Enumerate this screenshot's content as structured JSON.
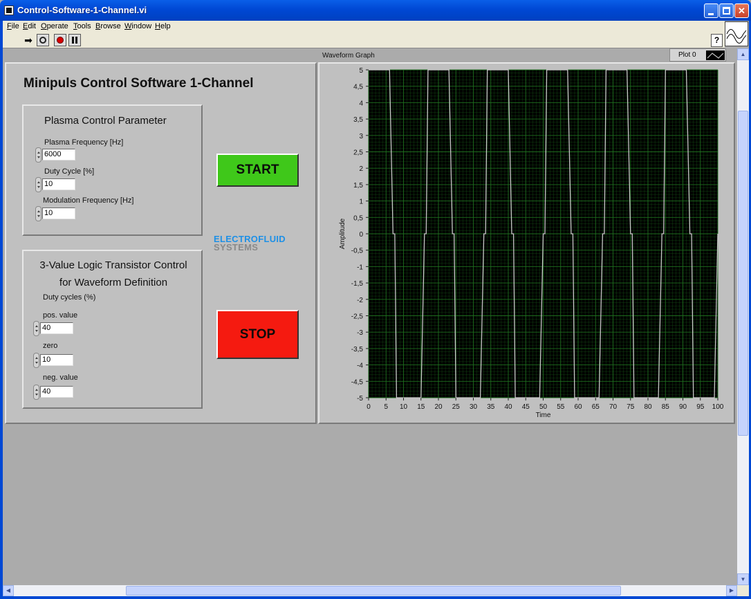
{
  "window": {
    "title": "Control-Software-1-Channel.vi"
  },
  "menu": [
    "File",
    "Edit",
    "Operate",
    "Tools",
    "Browse",
    "Window",
    "Help"
  ],
  "toolbar": {
    "run_icon": "run-arrow-icon",
    "run_cont_icon": "run-continuously-icon",
    "abort_icon": "abort-icon",
    "pause_icon": "pause-icon",
    "help_label": "?"
  },
  "front_panel": {
    "title": "Minipuls Control Software 1-Channel",
    "plasma": {
      "title": "Plasma Control Parameter",
      "frequency_label": "Plasma Frequency [Hz]",
      "frequency_value": "6000",
      "duty_label": "Duty Cycle [%]",
      "duty_value": "10",
      "mod_label": "Modulation Frequency [Hz]",
      "mod_value": "10"
    },
    "logic": {
      "title_line1": "3-Value Logic Transistor Control",
      "title_line2": "for Waveform Definition",
      "subtitle": "Duty cycles (%)",
      "pos_label": "pos. value",
      "pos_value": "40",
      "zero_label": "zero",
      "zero_value": "10",
      "neg_label": "neg. value",
      "neg_value": "40"
    },
    "start_label": "START",
    "stop_label": "STOP",
    "start_color": "#3fc81a",
    "stop_color": "#f51a10",
    "logo_line1": "ELECTROFLUID",
    "logo_line2": "SYSTEMS"
  },
  "graph": {
    "label": "Waveform Graph",
    "legend_name": "Plot 0"
  },
  "chart_data": {
    "type": "line",
    "xlabel": "Time",
    "ylabel": "Amplitude",
    "xlim": [
      0,
      100
    ],
    "ylim": [
      -5,
      5
    ],
    "x_ticks": [
      "0",
      "5",
      "10",
      "15",
      "20",
      "25",
      "30",
      "35",
      "40",
      "45",
      "50",
      "55",
      "60",
      "65",
      "70",
      "75",
      "80",
      "85",
      "90",
      "95",
      "100"
    ],
    "y_ticks": [
      "5",
      "4,5",
      "4",
      "3,5",
      "3",
      "2,5",
      "2",
      "1,5",
      "1",
      "0,5",
      "0",
      "-0,5",
      "-1",
      "-1,5",
      "-2",
      "-2,5",
      "-3",
      "-3,5",
      "-4",
      "-4,5",
      "-5"
    ],
    "plot_bg": "#000000",
    "grid_color": "#1e6e1e",
    "line_color": "#c8c8c8",
    "series": [
      {
        "x": [
          0,
          6,
          7,
          7.5,
          8,
          9,
          15,
          16,
          16.5,
          17,
          23,
          24,
          24.5,
          25,
          31,
          32,
          33,
          33.5,
          34,
          40,
          41,
          41.5,
          42,
          48,
          49,
          50,
          50.5,
          51,
          57,
          58,
          58.5,
          59,
          65,
          66,
          67,
          67.5,
          68,
          74,
          75,
          75.5,
          76,
          82,
          83,
          84,
          84.5,
          85,
          91,
          92,
          92.5,
          93,
          99,
          100
        ],
        "y": [
          5,
          5,
          0,
          0,
          -5,
          -5,
          -5,
          0,
          0,
          5,
          5,
          0,
          0,
          -5,
          -5,
          -5,
          0,
          0,
          5,
          5,
          0,
          0,
          -5,
          -5,
          -5,
          0,
          0,
          5,
          5,
          0,
          0,
          -5,
          -5,
          -5,
          0,
          0,
          5,
          5,
          0,
          0,
          -5,
          -5,
          -5,
          0,
          0,
          5,
          5,
          0,
          0,
          -5,
          -5,
          0
        ]
      }
    ]
  }
}
